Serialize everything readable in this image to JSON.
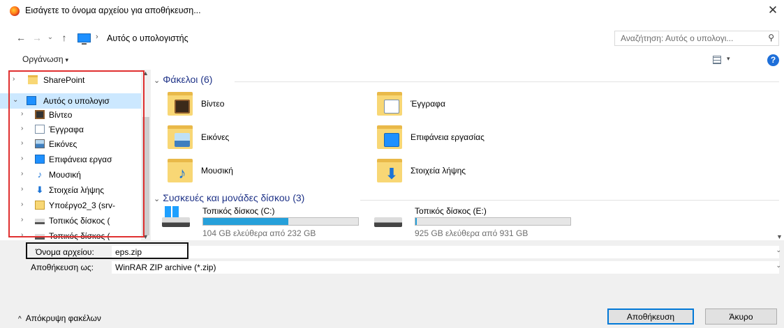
{
  "window": {
    "title": "Εισάγετε το όνομα αρχείου για αποθήκευση...",
    "close_glyph": "✕"
  },
  "address_bar": {
    "back_glyph": "←",
    "forward_glyph": "→",
    "recent_glyph": "⌄",
    "up_glyph": "↑",
    "breadcrumb_sep": "›",
    "location": "Αυτός ο υπολογιστής",
    "dropdown_glyph": "⌄",
    "refresh_glyph": "↻",
    "search_placeholder": "Αναζήτηση: Αυτός ο υπολογι...",
    "search_icon": "⚲"
  },
  "toolbar": {
    "organize_label": "Οργάνωση",
    "caret": "▾",
    "help_label": "?"
  },
  "nav_tree": {
    "items": [
      {
        "label": "SharePoint",
        "icon": "folder-icon",
        "expanded": false
      },
      {
        "label": "Αυτός ο υπολογισ",
        "icon": "computer-icon",
        "expanded": true,
        "selected": true
      },
      {
        "label": "Βίντεο",
        "icon": "video-icon"
      },
      {
        "label": "Έγγραφα",
        "icon": "documents-icon"
      },
      {
        "label": "Εικόνες",
        "icon": "pictures-icon"
      },
      {
        "label": "Επιφάνεια εργασ",
        "icon": "desktop-icon"
      },
      {
        "label": "Μουσική",
        "icon": "music-icon"
      },
      {
        "label": "Στοιχεία λήψης",
        "icon": "downloads-icon"
      },
      {
        "label": "Υποέργο2_3 (srv-",
        "icon": "network-drive-icon"
      },
      {
        "label": "Τοπικός δίσκος (",
        "icon": "local-disk-icon"
      },
      {
        "label": "Τοπικός δίσκος (",
        "icon": "local-disk-icon"
      }
    ],
    "collapsed_arrow": "›",
    "expanded_arrow": "⌄"
  },
  "folders_section": {
    "header": "Φάκελοι (6)",
    "items": [
      {
        "label": "Βίντεο",
        "icon": "video-folder-icon"
      },
      {
        "label": "Έγγραφα",
        "icon": "documents-folder-icon"
      },
      {
        "label": "Εικόνες",
        "icon": "pictures-folder-icon"
      },
      {
        "label": "Επιφάνεια εργασίας",
        "icon": "desktop-folder-icon"
      },
      {
        "label": "Μουσική",
        "icon": "music-folder-icon"
      },
      {
        "label": "Στοιχεία λήψης",
        "icon": "downloads-folder-icon"
      }
    ]
  },
  "devices_section": {
    "header": "Συσκευές και μονάδες δίσκου (3)",
    "drives": [
      {
        "name": "Τοπικός δίσκος (C:)",
        "free_text": "104 GB ελεύθερα από 232 GB",
        "used_fraction": 0.55,
        "icon": "windows-drive-icon"
      },
      {
        "name": "Τοπικός δίσκος (E:)",
        "free_text": "925 GB ελεύθερα από 931 GB",
        "used_fraction": 0.01,
        "icon": "drive-icon"
      }
    ]
  },
  "fields": {
    "filename_label": "Όνομα αρχείου:",
    "filename_value": "eps.zip",
    "save_as_label": "Αποθήκευση ως:",
    "save_as_value": "WinRAR ZIP archive (*.zip)",
    "dropdown_glyph": "⌄"
  },
  "footer": {
    "hide_folders_chevron": "^",
    "hide_folders_label": "Απόκρυψη φακέλων",
    "save_button": "Αποθήκευση",
    "cancel_button": "Άκυρο"
  },
  "colors": {
    "accent": "#0078d7",
    "section_header": "#1e3287",
    "highlight_frame": "#e03030",
    "drive_bar_fill": "#26a0da"
  }
}
